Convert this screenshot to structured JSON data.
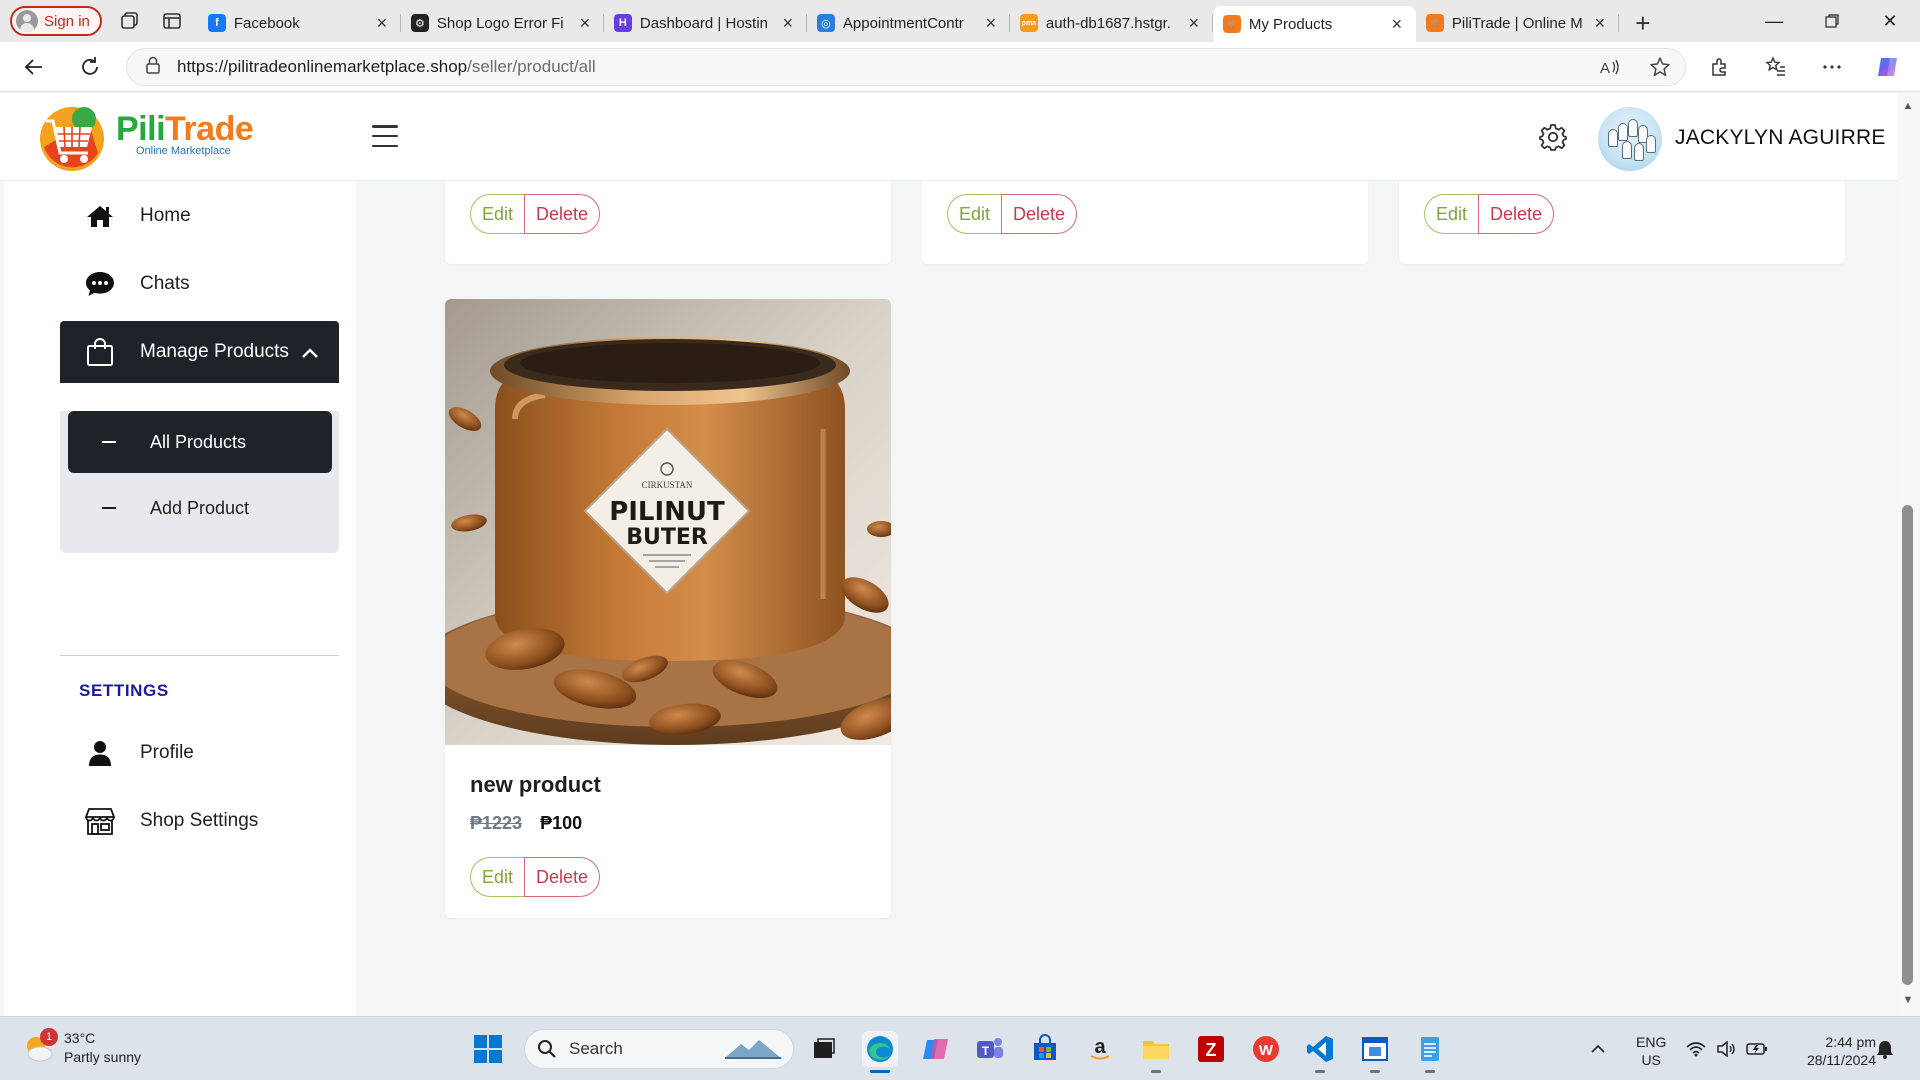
{
  "browser": {
    "sign_in_label": "Sign in",
    "tabs": [
      {
        "title": "Facebook",
        "favicon_color": "#1877f2",
        "favicon_glyph": "f"
      },
      {
        "title": "Shop Logo Error Fi",
        "favicon_color": "#222222",
        "favicon_glyph": "⚙"
      },
      {
        "title": "Dashboard | Hostin",
        "favicon_color": "#673de6",
        "favicon_glyph": "H"
      },
      {
        "title": "AppointmentContr",
        "favicon_color": "#2a7de1",
        "favicon_glyph": "◎"
      },
      {
        "title": "auth-db1687.hstgr.",
        "favicon_color": "#f29b1d",
        "favicon_glyph": "pma"
      },
      {
        "title": "My Products",
        "favicon_color": "#f47b1d",
        "favicon_glyph": "🛒"
      },
      {
        "title": "PiliTrade | Online M",
        "favicon_color": "#f47b1d",
        "favicon_glyph": "🛒"
      }
    ],
    "active_tab_index": 5,
    "url_host": "https://pilitradeonlinemarketplace.shop",
    "url_path": "/seller/product/all"
  },
  "header": {
    "brand_part1": "Pili",
    "brand_part2": "Trade",
    "brand_sub": "Online Marketplace",
    "username": "JACKYLYN AGUIRRE"
  },
  "sidebar": {
    "home": "Home",
    "chats": "Chats",
    "manage_products": "Manage Products",
    "all_products": "All Products",
    "add_product": "Add Product",
    "settings_heading": "SETTINGS",
    "profile": "Profile",
    "shop_settings": "Shop Settings"
  },
  "products": {
    "edit_label": "Edit",
    "delete_label": "Delete",
    "featured": {
      "name": "new product",
      "old_price": "₱1223",
      "new_price": "₱100",
      "label_line1": "PILINUT",
      "label_line2": "BUTER"
    }
  },
  "taskbar": {
    "temperature": "33°C",
    "weather": "Partly sunny",
    "notification_count": "1",
    "search_placeholder": "Search",
    "lang_line1": "ENG",
    "lang_line2": "US",
    "time": "2:44 pm",
    "date": "28/11/2024"
  },
  "colors": {
    "brand_green": "#27a83a",
    "brand_orange": "#f47b1d",
    "sidebar_active": "#1e2329",
    "edit_green": "#7fa63c",
    "delete_red": "#c73a4a",
    "settings_heading": "#1a1a9e"
  }
}
